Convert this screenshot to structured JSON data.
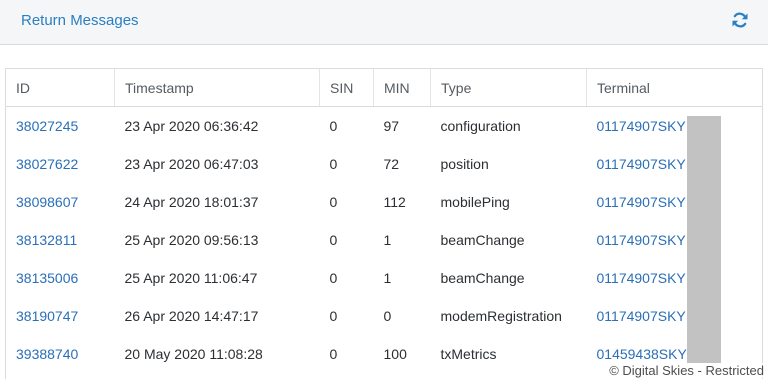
{
  "header": {
    "title": "Return Messages",
    "refresh_icon": "refresh-icon",
    "accent_color": "#2a7fc2"
  },
  "table": {
    "columns": [
      "ID",
      "Timestamp",
      "SIN",
      "MIN",
      "Type",
      "Terminal"
    ],
    "rows": [
      {
        "id": "38027245",
        "timestamp": "23 Apr 2020 06:36:42",
        "sin": "0",
        "min": "97",
        "type": "configuration",
        "terminal": "01174907SKY"
      },
      {
        "id": "38027622",
        "timestamp": "23 Apr 2020 06:47:03",
        "sin": "0",
        "min": "72",
        "type": "position",
        "terminal": "01174907SKY"
      },
      {
        "id": "38098607",
        "timestamp": "24 Apr 2020 18:01:37",
        "sin": "0",
        "min": "112",
        "type": "mobilePing",
        "terminal": "01174907SKY"
      },
      {
        "id": "38132811",
        "timestamp": "25 Apr 2020 09:56:13",
        "sin": "0",
        "min": "1",
        "type": "beamChange",
        "terminal": "01174907SKY"
      },
      {
        "id": "38135006",
        "timestamp": "25 Apr 2020 11:06:47",
        "sin": "0",
        "min": "1",
        "type": "beamChange",
        "terminal": "01174907SKY"
      },
      {
        "id": "38190747",
        "timestamp": "26 Apr 2020 14:47:17",
        "sin": "0",
        "min": "0",
        "type": "modemRegistration",
        "terminal": "01174907SKY"
      },
      {
        "id": "39388740",
        "timestamp": "20 May 2020 11:08:28",
        "sin": "0",
        "min": "100",
        "type": "txMetrics",
        "terminal": "01459438SKY"
      }
    ]
  },
  "watermark": "© Digital Skies - Restricted"
}
